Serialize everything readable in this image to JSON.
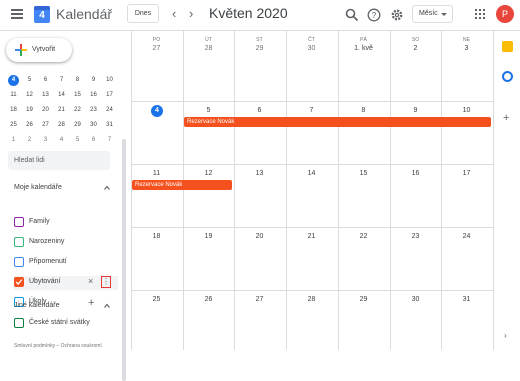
{
  "header": {
    "app_title": "Kalendář",
    "logo_day": "4",
    "today_label": "Dnes",
    "prev_icon": "chevron-left-icon",
    "next_icon": "chevron-right-icon",
    "month_title": "Květen 2020",
    "view_label": "Měsíc",
    "avatar_letter": "P"
  },
  "sidebar": {
    "create_label": "Vytvořit",
    "search_people_placeholder": "Hledat lidi",
    "my_calendars_label": "Moje kalendáře",
    "other_calendars_label": "Jiné kalendáře",
    "my_calendars": [
      {
        "label": "Family",
        "color": "#8e24aa",
        "checked": false
      },
      {
        "label": "Narozeniny",
        "color": "#33b679",
        "checked": false
      },
      {
        "label": "Připomenutí",
        "color": "#4285f4",
        "checked": false
      },
      {
        "label": "Ubytování",
        "color": "#f4511e",
        "checked": true
      },
      {
        "label": "Úkoly",
        "color": "#039be5",
        "checked": false
      }
    ],
    "other_calendars": [
      {
        "label": "České státní svátky",
        "color": "#0b8043",
        "checked": false
      }
    ],
    "footer": "Smluvní podmínky – Ochrana soukromí",
    "mini_calendar": {
      "rows": [
        [
          "4",
          "5",
          "6",
          "7",
          "8",
          "9",
          "10"
        ],
        [
          "11",
          "12",
          "13",
          "14",
          "15",
          "16",
          "17"
        ],
        [
          "18",
          "19",
          "20",
          "21",
          "22",
          "23",
          "24"
        ],
        [
          "25",
          "26",
          "27",
          "28",
          "29",
          "30",
          "31"
        ],
        [
          "1",
          "2",
          "3",
          "4",
          "5",
          "6",
          "7"
        ]
      ],
      "today": "4"
    }
  },
  "calendar": {
    "weekdays": [
      "PO",
      "ÚT",
      "ST",
      "ČT",
      "PÁ",
      "SO",
      "NE"
    ],
    "weeks": [
      [
        "27",
        "28",
        "29",
        "30",
        "1. kvě",
        "2",
        "3"
      ],
      [
        "4",
        "5",
        "6",
        "7",
        "8",
        "9",
        "10"
      ],
      [
        "11",
        "12",
        "13",
        "14",
        "15",
        "16",
        "17"
      ],
      [
        "18",
        "19",
        "20",
        "21",
        "22",
        "23",
        "24"
      ],
      [
        "25",
        "26",
        "27",
        "28",
        "29",
        "30",
        "31"
      ]
    ],
    "today": "4",
    "events": [
      {
        "title": "Rezervace Novák",
        "week": 1,
        "start_col": 1,
        "span": 6,
        "color": "#f4511e"
      },
      {
        "title": "Rezervace Novák",
        "week": 2,
        "start_col": 0,
        "span": 2,
        "color": "#f4511e"
      }
    ]
  },
  "colors": {
    "accent": "#1a73e8",
    "event": "#f4511e",
    "avatar": "#e8453c"
  }
}
